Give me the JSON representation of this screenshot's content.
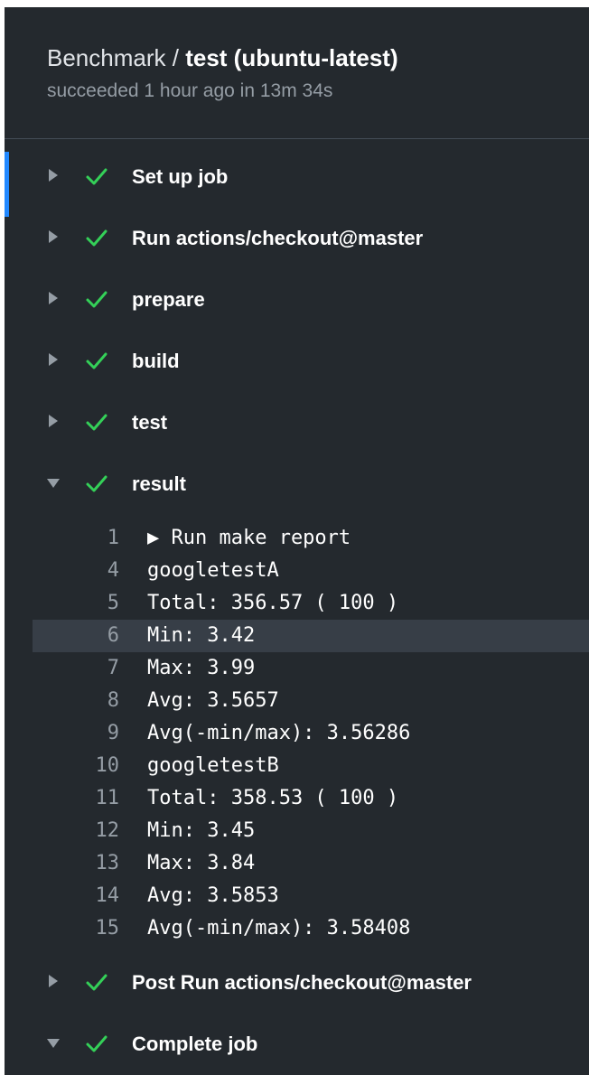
{
  "header": {
    "workflow": "Benchmark",
    "separator": "/",
    "job": "test (ubuntu-latest)",
    "status": "succeeded 1 hour ago in 13m 34s"
  },
  "steps": [
    {
      "name": "Set up job",
      "expanded": false,
      "status": "success"
    },
    {
      "name": "Run actions/checkout@master",
      "expanded": false,
      "status": "success"
    },
    {
      "name": "prepare",
      "expanded": false,
      "status": "success"
    },
    {
      "name": "build",
      "expanded": false,
      "status": "success"
    },
    {
      "name": "test",
      "expanded": false,
      "status": "success"
    },
    {
      "name": "result",
      "expanded": true,
      "status": "success"
    },
    {
      "name": "Post Run actions/checkout@master",
      "expanded": false,
      "status": "success"
    },
    {
      "name": "Complete job",
      "expanded": true,
      "status": "success"
    }
  ],
  "log": [
    {
      "num": "1",
      "text": "▶ Run make report"
    },
    {
      "num": "4",
      "text": "googletestA"
    },
    {
      "num": "5",
      "text": "Total: 356.57 ( 100 )"
    },
    {
      "num": "6",
      "text": "Min: 3.42",
      "highlighted": true
    },
    {
      "num": "7",
      "text": "Max: 3.99"
    },
    {
      "num": "8",
      "text": "Avg: 3.5657"
    },
    {
      "num": "9",
      "text": "Avg(-min/max): 3.56286"
    },
    {
      "num": "10",
      "text": "googletestB"
    },
    {
      "num": "11",
      "text": "Total: 358.53 ( 100 )"
    },
    {
      "num": "12",
      "text": "Min: 3.45"
    },
    {
      "num": "13",
      "text": "Max: 3.84"
    },
    {
      "num": "14",
      "text": "Avg: 3.5853"
    },
    {
      "num": "15",
      "text": "Avg(-min/max): 3.58408"
    }
  ],
  "icons": {
    "collapsed": "caret-right-icon",
    "expanded": "caret-down-icon",
    "success": "check-icon"
  },
  "colors": {
    "background": "#24292e",
    "success": "#34d058",
    "muted": "#959da5",
    "highlight": "#373e47",
    "accent": "#2188ff"
  }
}
